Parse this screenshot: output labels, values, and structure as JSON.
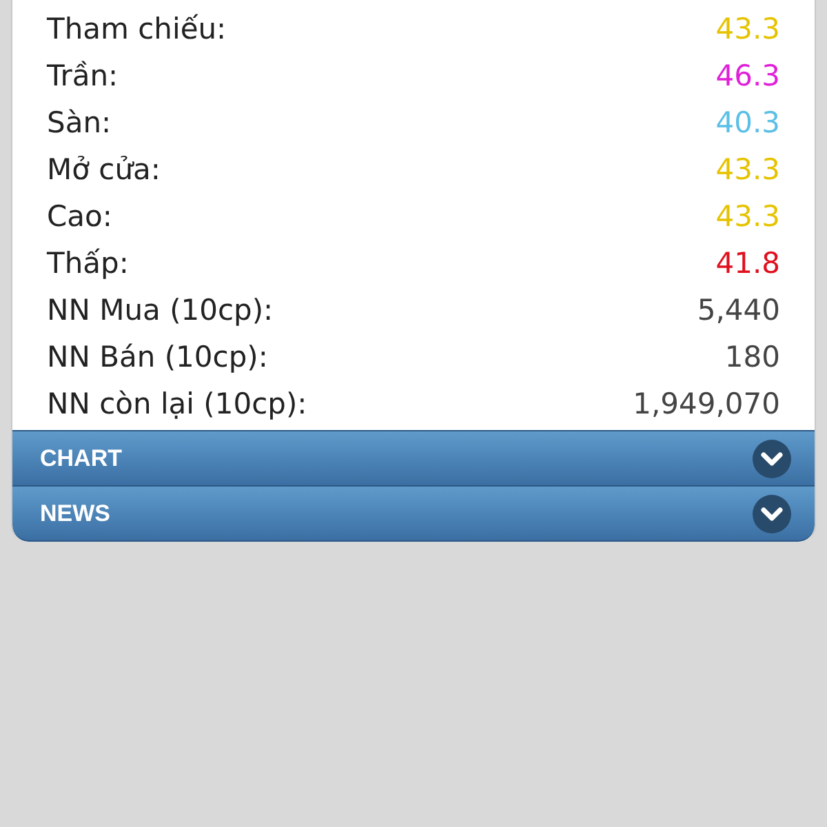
{
  "rows": [
    {
      "label": "Tham chiếu:",
      "value": "43.3",
      "color": "#e6c300"
    },
    {
      "label": "Trần:",
      "value": "46.3",
      "color": "#e020d8"
    },
    {
      "label": "Sàn:",
      "value": "40.3",
      "color": "#5bbfe6"
    },
    {
      "label": "Mở cửa:",
      "value": "43.3",
      "color": "#e6c300"
    },
    {
      "label": "Cao:",
      "value": "43.3",
      "color": "#e6c300"
    },
    {
      "label": "Thấp:",
      "value": "41.8",
      "color": "#e0101e"
    },
    {
      "label": "NN Mua (10cp):",
      "value": "5,440",
      "color": "#444444"
    },
    {
      "label": "NN Bán (10cp):",
      "value": "180",
      "color": "#444444"
    },
    {
      "label": "NN còn lại (10cp):",
      "value": "1,949,070",
      "color": "#444444"
    }
  ],
  "sections": [
    {
      "label": "CHART",
      "expanded": false
    },
    {
      "label": "NEWS",
      "expanded": false
    }
  ]
}
